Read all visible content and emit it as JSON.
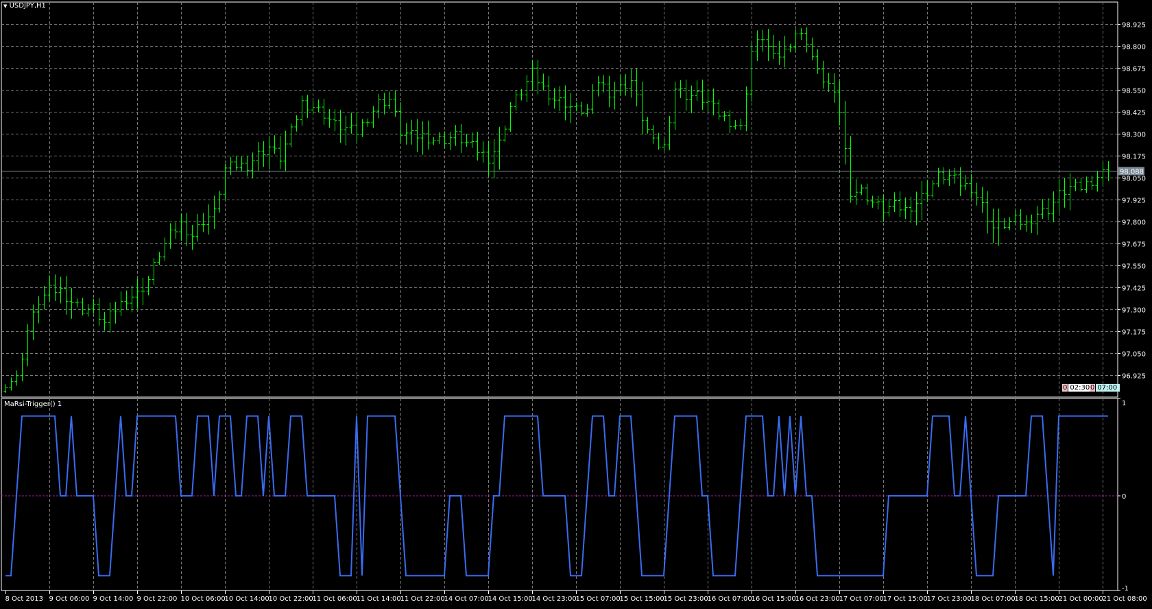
{
  "window": {
    "title": "USDJPY,H1"
  },
  "indicator": {
    "label": "MaRsi-Trigger() 1"
  },
  "countdown": [
    {
      "count": "0",
      "time": "02:30"
    },
    {
      "count": "0",
      "time": "07:00"
    }
  ],
  "colors": {
    "bars": "#00ff00",
    "indicator_line": "#3a6cf0",
    "zero_line": "#a020a0",
    "grid": "#7a7a7a",
    "current_price_bg": "#7b8a96"
  },
  "chart_data": [
    {
      "type": "ohlc",
      "symbol": "USDJPY",
      "timeframe": "H1",
      "bar_count": 202,
      "close_sampled_every_2_bars": [
        96.883,
        96.904,
        97.177,
        97.344,
        97.407,
        97.407,
        97.344,
        97.302,
        97.302,
        97.219,
        97.302,
        97.365,
        97.386,
        97.47,
        97.616,
        97.722,
        97.785,
        97.722,
        97.806,
        97.848,
        98.099,
        98.12,
        98.12,
        98.183,
        98.225,
        98.162,
        98.309,
        98.476,
        98.455,
        98.413,
        98.351,
        98.33,
        98.309,
        98.393,
        98.476,
        98.497,
        98.309,
        98.288,
        98.288,
        98.267,
        98.267,
        98.288,
        98.246,
        98.204,
        98.162,
        98.246,
        98.455,
        98.539,
        98.644,
        98.56,
        98.497,
        98.476,
        98.434,
        98.434,
        98.602,
        98.539,
        98.56,
        98.602,
        98.393,
        98.246,
        98.225,
        98.56,
        98.518,
        98.518,
        98.476,
        98.413,
        98.372,
        98.33,
        98.77,
        98.854,
        98.728,
        98.77,
        98.875,
        98.833,
        98.644,
        98.581,
        98.434,
        97.973,
        97.973,
        97.91,
        97.868,
        97.889,
        97.868,
        97.91,
        97.973,
        98.057,
        98.057,
        98.015,
        97.994,
        97.889,
        97.764,
        97.785,
        97.806,
        97.785,
        97.848,
        97.868,
        97.952,
        97.994,
        97.994,
        98.036,
        98.078,
        98.088
      ],
      "current_price": "98.088",
      "ylim": [
        96.8,
        99.05
      ],
      "y_ticks": [
        "98.925",
        "98.800",
        "98.675",
        "98.550",
        "98.425",
        "98.300",
        "98.175",
        "98.050",
        "97.925",
        "97.800",
        "97.675",
        "97.550",
        "97.425",
        "97.300",
        "97.175",
        "97.050",
        "96.925"
      ],
      "x_ticks": [
        "8 Oct 2013",
        "9 Oct 06:00",
        "9 Oct 14:00",
        "9 Oct 22:00",
        "10 Oct 06:00",
        "10 Oct 14:00",
        "10 Oct 22:00",
        "11 Oct 06:00",
        "11 Oct 14:00",
        "11 Oct 22:00",
        "14 Oct 07:00",
        "14 Oct 15:00",
        "14 Oct 23:00",
        "15 Oct 07:00",
        "15 Oct 15:00",
        "15 Oct 23:00",
        "16 Oct 07:00",
        "16 Oct 15:00",
        "16 Oct 23:00",
        "17 Oct 07:00",
        "17 Oct 15:00",
        "17 Oct 23:00",
        "18 Oct 07:00",
        "18 Oct 15:00",
        "21 Oct 00:00",
        "21 Oct 08:00"
      ],
      "x_tick_every_bars": 8,
      "grid": true
    },
    {
      "type": "line",
      "name": "MaRsi-Trigger",
      "amplitude": 0.84,
      "ylim": [
        -1,
        1
      ],
      "y_ticks": [
        "1",
        "0",
        "-1"
      ],
      "values": [
        -1,
        -1,
        0,
        1,
        1,
        1,
        1,
        1,
        1,
        1,
        0,
        0,
        1,
        0,
        0,
        0,
        0,
        -1,
        -1,
        -1,
        0,
        1,
        0,
        0,
        1,
        1,
        1,
        1,
        1,
        1,
        1,
        1,
        0,
        0,
        0,
        1,
        1,
        1,
        0,
        1,
        1,
        1,
        0,
        0,
        1,
        1,
        1,
        0,
        1,
        0,
        0,
        0,
        1,
        1,
        1,
        0,
        0,
        0,
        0,
        0,
        0,
        -1,
        -1,
        -1,
        1,
        -1,
        1,
        1,
        1,
        1,
        1,
        1,
        0,
        -1,
        -1,
        -1,
        -1,
        -1,
        -1,
        -1,
        -1,
        0,
        0,
        0,
        -1,
        -1,
        -1,
        -1,
        -1,
        0,
        0,
        1,
        1,
        1,
        1,
        1,
        1,
        1,
        0,
        0,
        0,
        0,
        0,
        -1,
        -1,
        -1,
        0,
        1,
        1,
        1,
        0,
        0,
        1,
        1,
        1,
        0,
        -1,
        -1,
        -1,
        -1,
        -1,
        0,
        1,
        1,
        1,
        1,
        1,
        0,
        0,
        -1,
        -1,
        -1,
        -1,
        -1,
        0,
        1,
        1,
        1,
        1,
        0,
        0,
        1,
        0,
        1,
        0,
        1,
        0,
        0,
        -1,
        -1,
        -1,
        -1,
        -1,
        -1,
        -1,
        -1,
        -1,
        -1,
        -1,
        -1,
        -1,
        0,
        0,
        0,
        0,
        0,
        0,
        0,
        0,
        1,
        1,
        1,
        1,
        0,
        0,
        1,
        0,
        -1,
        -1,
        -1,
        -1,
        0,
        0,
        0,
        0,
        0,
        0,
        1,
        1,
        1,
        0,
        -1,
        1,
        1,
        1,
        1,
        1,
        1,
        1,
        1,
        1,
        1
      ]
    }
  ]
}
